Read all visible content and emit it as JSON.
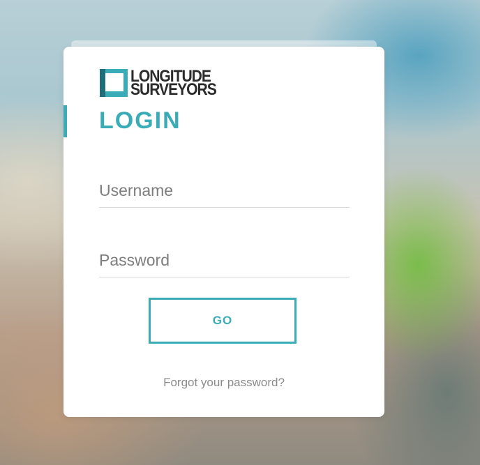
{
  "logo": {
    "line1": "LONGITUDE",
    "line2": "SURVEYORS"
  },
  "login": {
    "title": "LOGIN",
    "username_placeholder": "Username",
    "password_placeholder": "Password",
    "go_label": "GO",
    "forgot_label": "Forgot your password?"
  },
  "colors": {
    "accent": "#3aacb8",
    "logo_dark": "#1f6f7a",
    "text_dark": "#2b2b2b",
    "muted": "#8a8a8a"
  }
}
